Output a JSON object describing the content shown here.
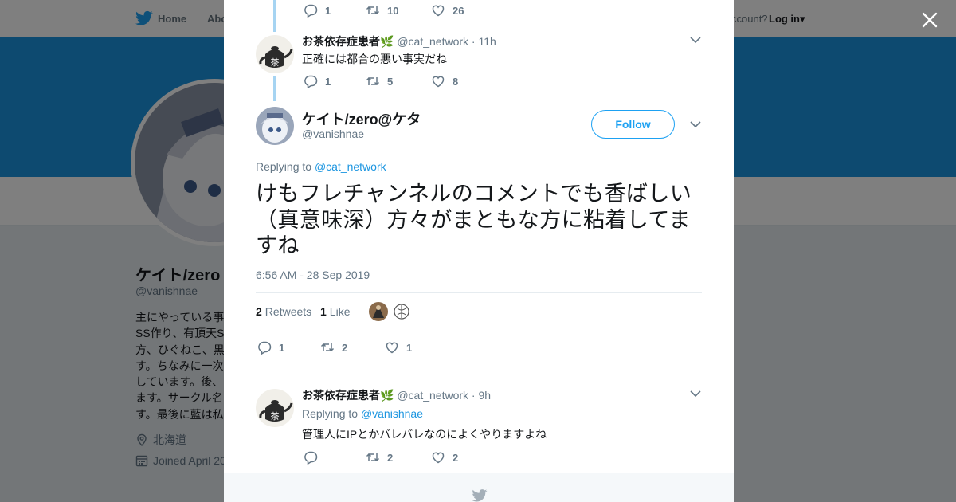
{
  "topnav": {
    "home_label": "Home",
    "about_label": "Abo",
    "account_prompt": "ccount?",
    "login_label": "Log in"
  },
  "profile": {
    "name": "ケイト/zero",
    "handle": "@vanishnae",
    "bio": "主にやっている事\nSS作り、有頂天S\n方、ひぐねこ、黒\nす。ちなみに一次\nしています。後、\nます。サークル名\nす。最後に藍は私",
    "location": "北海道",
    "joined": "Joined April 20"
  },
  "thread": {
    "top_actions": {
      "replies": "1",
      "retweets": "10",
      "likes": "26"
    },
    "reply1": {
      "name": "お茶依存症患者",
      "handle": "@cat_network",
      "time": "· 11h",
      "text": "正確には都合の悪い事実だね",
      "actions": {
        "replies": "1",
        "retweets": "5",
        "likes": "8"
      }
    },
    "main": {
      "name": "ケイト/zero@ケタ",
      "handle": "@vanishnae",
      "follow_label": "Follow",
      "replying_prefix": "Replying to ",
      "replying_to": "@cat_network",
      "text": "けもフレチャンネルのコメントでも香ばしい（真意味深）方々がまともな方に粘着してますね",
      "timestamp": "6:56 AM - 28 Sep 2019",
      "retweets_count": "2",
      "retweets_label": "Retweets",
      "likes_count": "1",
      "likes_label": "Like",
      "actions": {
        "replies": "1",
        "retweets": "2",
        "likes": "1"
      }
    },
    "reply2": {
      "name": "お茶依存症患者",
      "handle": "@cat_network",
      "time": "· 9h",
      "replying_prefix": "Replying to ",
      "replying_to": "@vanishnae",
      "text": "管理人にIPとかバレバレなのによくやりますよね",
      "actions": {
        "replies": "",
        "retweets": "2",
        "likes": "2"
      }
    }
  },
  "colors": {
    "brand": "#1da1f2",
    "link": "#1b95e0",
    "banner": "#1b95e0",
    "thread_line": "#a6d4f2"
  },
  "icons": [
    "twitter-bird-icon",
    "reply-icon",
    "retweet-icon",
    "heart-icon",
    "chevron-down-icon",
    "close-icon",
    "location-icon",
    "calendar-icon",
    "leaf-emoji-icon"
  ]
}
